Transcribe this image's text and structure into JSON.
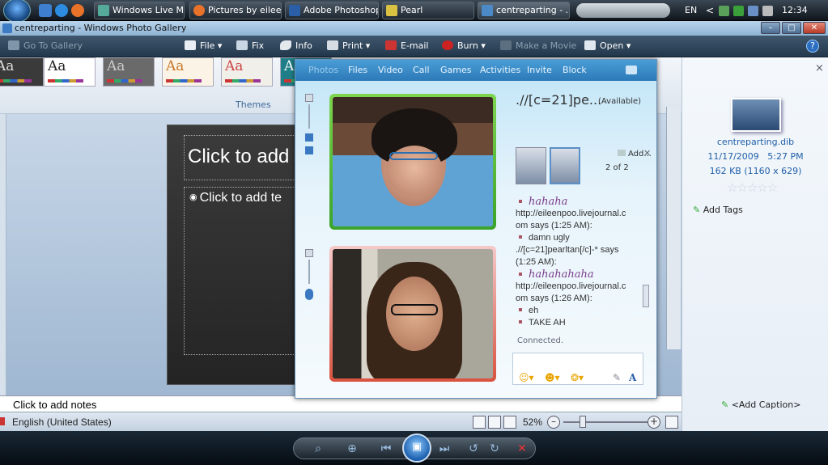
{
  "taskbar": {
    "tasks": [
      {
        "label": "Windows Live M..."
      },
      {
        "label": "Pictures by eilee..."
      },
      {
        "label": "Adobe Photoshop"
      },
      {
        "label": "Pearl"
      },
      {
        "label": "centreparting - ..."
      }
    ],
    "language": "EN",
    "clock": "12:34 PM"
  },
  "window": {
    "title": "centreparting - Windows Photo Gallery",
    "min_glyph": "–",
    "max_glyph": "□",
    "close_glyph": "✕"
  },
  "toolbar": {
    "back_label": "Go To Gallery",
    "file_label": "File",
    "fix_label": "Fix",
    "info_label": "Info",
    "print_label": "Print",
    "email_label": "E-mail",
    "burn_label": "Burn",
    "movie_label": "Make a Movie",
    "open_label": "Open",
    "help_glyph": "?"
  },
  "slide": {
    "themes_label": "Themes",
    "theme_glyph": "Aa",
    "title_placeholder": "Click to add",
    "body_placeholder": "Click to add te",
    "notes_placeholder": "Click to add notes",
    "language": "English (United States)",
    "zoom": "52%"
  },
  "info_pane": {
    "file_name": "centreparting.dib",
    "date": "11/17/2009",
    "time": "5:27 PM",
    "size": "162 KB (1160 x 629)",
    "rating_stars": "☆☆☆☆☆",
    "add_tags_label": "Add Tags",
    "add_caption_label": "<Add Caption>",
    "close_glyph": "×"
  },
  "messenger": {
    "tabs": [
      "Photos",
      "Files",
      "Video",
      "Call",
      "Games",
      "Activities",
      "Invite",
      "Block"
    ],
    "contact_name": ".//[c=21]pe...",
    "contact_status": "(Available)",
    "add_label": "Add...",
    "page_count": "2 of 2",
    "connected_label": "Connected.",
    "chat": [
      {
        "kind": "fancy",
        "text": "hahaha"
      },
      {
        "kind": "plain",
        "text": "http://eileenpoo.livejournal.c"
      },
      {
        "kind": "plain",
        "text": "om says (1:25 AM):"
      },
      {
        "kind": "bullet",
        "text": "damn ugly"
      },
      {
        "kind": "plain",
        "text": ".//[c=21]pearltan[/c]-* says"
      },
      {
        "kind": "plain",
        "text": "(1:25 AM):"
      },
      {
        "kind": "fancy",
        "text": "hahahahaha"
      },
      {
        "kind": "plain",
        "text": "http://eileenpoo.livejournal.c"
      },
      {
        "kind": "plain",
        "text": "om says (1:26 AM):"
      },
      {
        "kind": "bullet",
        "text": "eh"
      },
      {
        "kind": "bullet",
        "text": "TAKE AH"
      }
    ]
  },
  "colors": {
    "taskbar": "#1f2831",
    "toolbar": "#2f475e",
    "cam_top_frame": "#58c23a",
    "cam_bottom_frame": "#e06a5a",
    "chat_fancy": "#7a3d8c"
  }
}
